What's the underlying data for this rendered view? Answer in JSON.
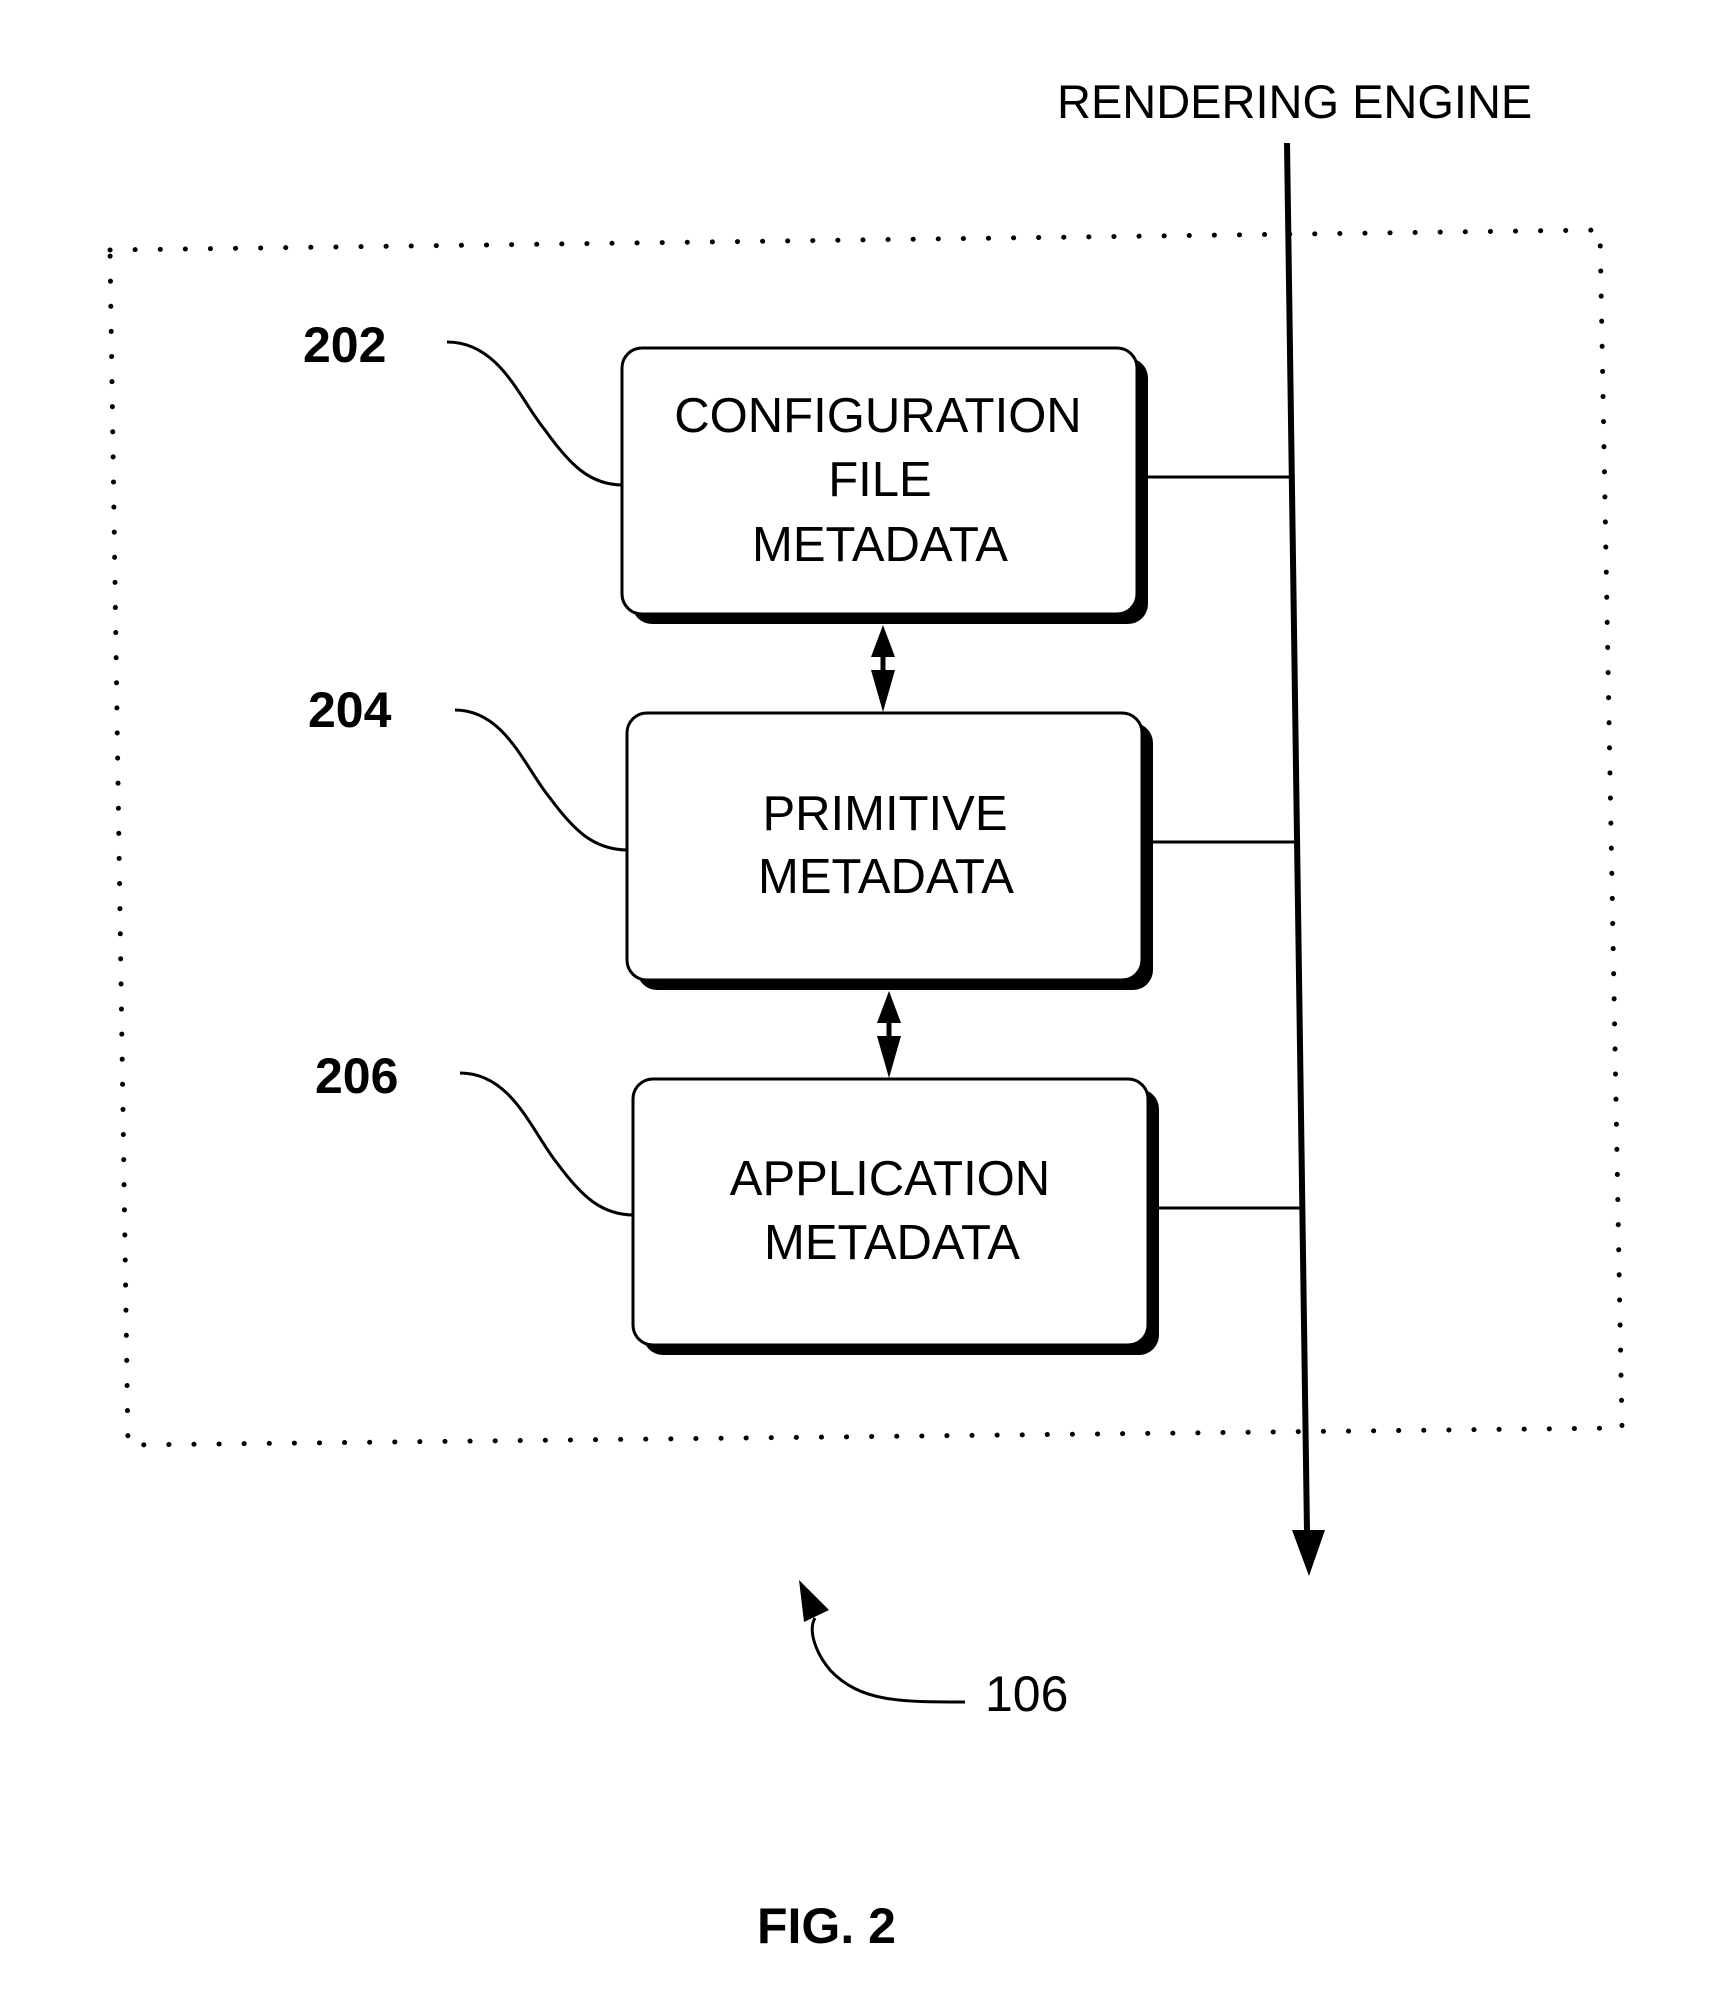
{
  "figure": {
    "caption": "FIG. 2",
    "system_reference": "106",
    "rendering_engine_label": "RENDERING ENGINE",
    "blocks": [
      {
        "ref": "202",
        "lines": [
          "CONFIGURATION",
          "FILE",
          "METADATA"
        ]
      },
      {
        "ref": "204",
        "lines": [
          "PRIMITIVE",
          "METADATA"
        ]
      },
      {
        "ref": "206",
        "lines": [
          "APPLICATION",
          "METADATA"
        ]
      }
    ],
    "connections": [
      {
        "from": "202",
        "to": "204",
        "type": "bidirectional"
      },
      {
        "from": "204",
        "to": "206",
        "type": "bidirectional"
      },
      {
        "from": "202",
        "to": "rendering-engine",
        "type": "line"
      },
      {
        "from": "204",
        "to": "rendering-engine",
        "type": "line"
      },
      {
        "from": "206",
        "to": "rendering-engine",
        "type": "line"
      }
    ],
    "colors": {
      "ink": "#000000",
      "paper": "#ffffff"
    }
  }
}
